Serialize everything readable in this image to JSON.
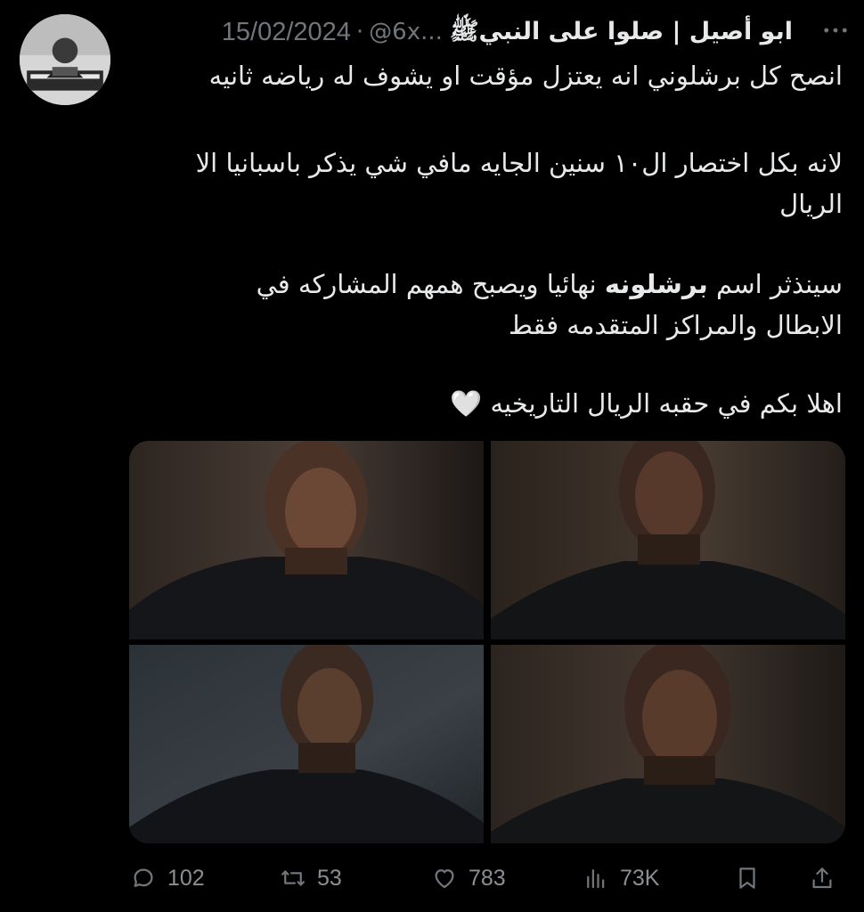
{
  "author": {
    "display_name": "ابو أصيل | صلوا على النبيﷺ",
    "handle": "@6x...",
    "separator": "·",
    "date": "15/02/2024",
    "avatar_icon": "avatar-photo-icon"
  },
  "tweet": {
    "lines": [
      "انصح كل برشلوني انه يعتزل مؤقت او يشوف له رياضه ثانيه",
      "لانه بكل اختصار ال١٠ سنين الجايه مافي شي يذكر باسبانيا الا",
      "الريال",
      "سينذثر اسم",
      "برشلونه",
      "نهائيا ويصبح همهم المشاركه في",
      "الابطال والمراكز المتقدمه فقط",
      "اهلا بكم في حقبه الريال التاريخيه"
    ],
    "emoji": "🤍"
  },
  "media": {
    "photos": [
      "player-photo-1",
      "player-photo-2",
      "player-photo-3",
      "player-photo-4"
    ]
  },
  "actions": {
    "replies": "102",
    "retweets": "53",
    "likes": "783",
    "views": "73K"
  },
  "colors": {
    "background": "#000000",
    "text": "#e7e9ea",
    "muted": "#71767b"
  }
}
